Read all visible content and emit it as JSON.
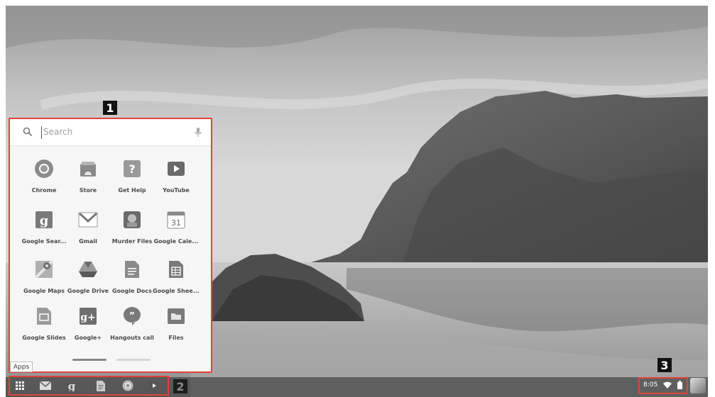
{
  "callouts": [
    "1",
    "2",
    "3"
  ],
  "launcher": {
    "search_placeholder": "Search",
    "apps": [
      {
        "label": "Chrome",
        "icon": "chrome-icon"
      },
      {
        "label": "Store",
        "icon": "store-icon"
      },
      {
        "label": "Get Help",
        "icon": "help-icon"
      },
      {
        "label": "YouTube",
        "icon": "youtube-icon"
      },
      {
        "label": "Google Sear...",
        "icon": "google-search-icon"
      },
      {
        "label": "Gmail",
        "icon": "gmail-icon"
      },
      {
        "label": "Murder Files",
        "icon": "murder-files-icon"
      },
      {
        "label": "Google Cale...",
        "icon": "calendar-icon",
        "glyph": "31"
      },
      {
        "label": "Google Maps",
        "icon": "maps-icon"
      },
      {
        "label": "Google Drive",
        "icon": "drive-icon"
      },
      {
        "label": "Google Docs",
        "icon": "docs-icon"
      },
      {
        "label": "Google Shee...",
        "icon": "sheets-icon"
      },
      {
        "label": "Google Slides",
        "icon": "slides-icon"
      },
      {
        "label": "Google+",
        "icon": "google-plus-icon",
        "glyph": "g+"
      },
      {
        "label": "Hangouts call",
        "icon": "hangouts-icon"
      },
      {
        "label": "Files",
        "icon": "files-icon"
      }
    ],
    "apps_tooltip": "Apps"
  },
  "shelf": {
    "items": [
      "launcher-icon",
      "gmail-icon",
      "google-search-icon",
      "docs-icon",
      "chrome-icon",
      "youtube-icon"
    ]
  },
  "status": {
    "time": "8:05",
    "icons": [
      "wifi-icon",
      "battery-icon"
    ]
  },
  "colors": {
    "highlight": "#e0433a",
    "callout_bg": "#111111"
  }
}
